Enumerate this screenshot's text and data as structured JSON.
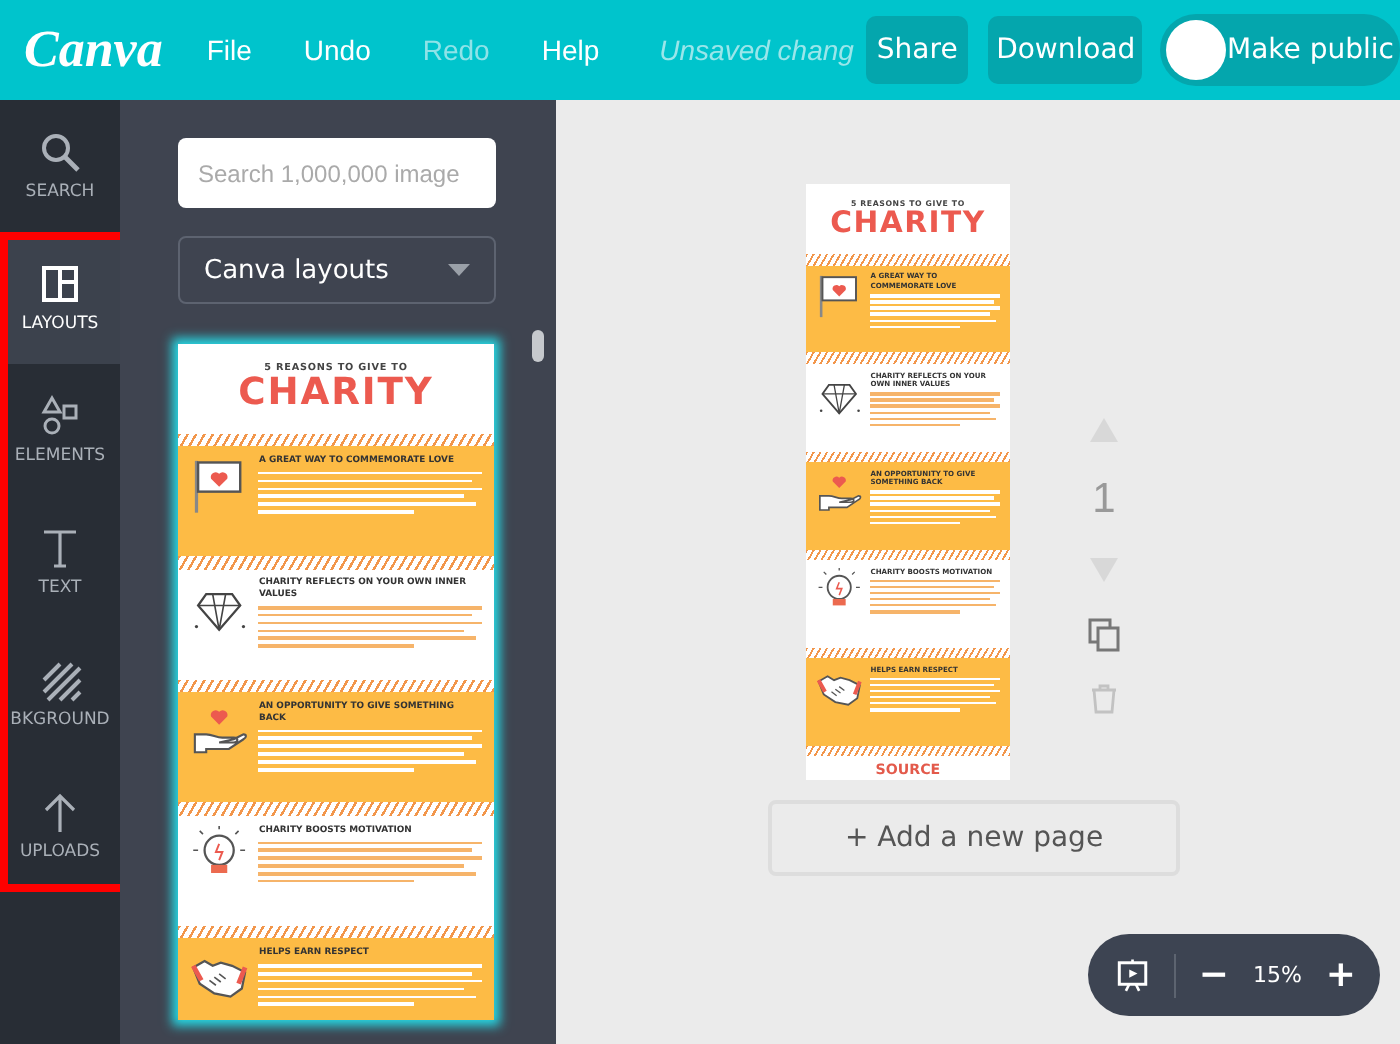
{
  "top_bar": {
    "logo": "Canva",
    "menu": [
      {
        "label": "File",
        "disabled": false
      },
      {
        "label": "Undo",
        "disabled": false
      },
      {
        "label": "Redo",
        "disabled": true
      },
      {
        "label": "Help",
        "disabled": false
      }
    ],
    "status": "Unsaved chang",
    "buttons": [
      {
        "label": "Share"
      },
      {
        "label": "Download"
      }
    ],
    "public_toggle": {
      "label": "Make public",
      "on": false
    }
  },
  "sidebar": {
    "items": [
      {
        "kind": "search",
        "label": "SEARCH",
        "selected": false,
        "highlighted": false
      },
      {
        "kind": "layouts",
        "label": "LAYOUTS",
        "selected": true,
        "highlighted": true
      },
      {
        "kind": "elements",
        "label": "ELEMENTS",
        "selected": false,
        "highlighted": true
      },
      {
        "kind": "text",
        "label": "TEXT",
        "selected": false,
        "highlighted": true
      },
      {
        "kind": "background",
        "label": "BKGROUND",
        "selected": false,
        "highlighted": true
      },
      {
        "kind": "uploads",
        "label": "UPLOADS",
        "selected": false,
        "highlighted": true
      }
    ]
  },
  "panel": {
    "search": {
      "placeholder": "Search 1,000,000 image"
    },
    "dropdown": {
      "value": "Canva layouts"
    },
    "layout": {
      "subtitle": "5 REASONS TO GIVE TO",
      "title": "CHARITY",
      "selected": true,
      "sections": [
        {
          "kind": "flag",
          "heading": "A GREAT WAY TO COMMEMORATE LOVE",
          "color": "#fdbb45"
        },
        {
          "kind": "diamond",
          "heading": "CHARITY REFLECTS ON YOUR OWN INNER VALUES",
          "color": "#ffffff"
        },
        {
          "kind": "hand",
          "heading": "AN OPPORTUNITY TO GIVE SOMETHING BACK",
          "color": "#fdbb45"
        },
        {
          "kind": "bulb",
          "heading": "CHARITY BOOSTS MOTIVATION",
          "color": "#ffffff"
        },
        {
          "kind": "handshake",
          "heading": "HELPS EARN RESPECT",
          "color": "#fdbb45"
        }
      ]
    }
  },
  "canvas": {
    "page": {
      "subtitle": "5 REASONS TO GIVE TO",
      "title": "CHARITY",
      "sections": [
        {
          "kind": "flag",
          "heading": "A GREAT WAY TO COMMEMORATE LOVE",
          "color": "#fdbb45"
        },
        {
          "kind": "diamond",
          "heading": "CHARITY REFLECTS ON YOUR OWN INNER VALUES",
          "color": "#ffffff"
        },
        {
          "kind": "hand",
          "heading": "AN OPPORTUNITY TO GIVE SOMETHING BACK",
          "color": "#fdbb45"
        },
        {
          "kind": "bulb",
          "heading": "CHARITY BOOSTS MOTIVATION",
          "color": "#ffffff"
        },
        {
          "kind": "handshake",
          "heading": "HELPS EARN RESPECT",
          "color": "#fdbb45"
        }
      ],
      "footer": "SOURCE"
    },
    "page_controls": [
      {
        "kind": "up",
        "disabled": true
      },
      {
        "kind": "number",
        "label": "1"
      },
      {
        "kind": "down",
        "disabled": true
      },
      {
        "kind": "copy",
        "disabled": false
      },
      {
        "kind": "trash",
        "disabled": true
      }
    ],
    "add_page": "+ Add a new page",
    "zoom": {
      "minus": "−",
      "value": "15%",
      "plus": "+"
    }
  }
}
